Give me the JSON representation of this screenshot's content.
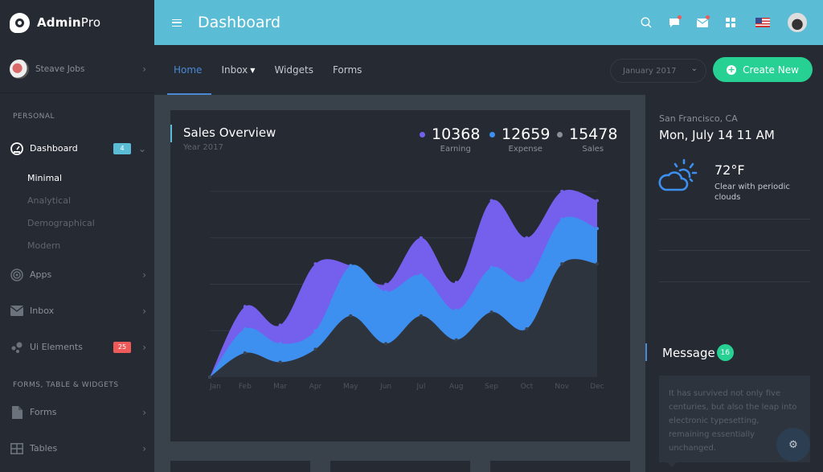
{
  "brand": {
    "bold": "Admin",
    "light": "Pro"
  },
  "user": {
    "name": "Steave Jobs"
  },
  "sidebar": {
    "sections": [
      {
        "title": "PERSONAL"
      },
      {
        "title": "FORMS, TABLE & WIDGETS"
      }
    ],
    "items": [
      {
        "label": "Dashboard",
        "icon": "dashboard-icon",
        "badge": "4",
        "badge_color": "#5bbdd5",
        "active": true,
        "children": [
          {
            "label": "Minimal",
            "active": true
          },
          {
            "label": "Analytical"
          },
          {
            "label": "Demographical"
          },
          {
            "label": "Modern"
          }
        ]
      },
      {
        "label": "Apps",
        "icon": "target-icon"
      },
      {
        "label": "Inbox",
        "icon": "envelope-icon"
      },
      {
        "label": "Ui Elements",
        "icon": "bubbles-icon",
        "badge": "25",
        "badge_color": "#ee5a5a"
      },
      {
        "label": "Forms",
        "icon": "file-icon"
      },
      {
        "label": "Tables",
        "icon": "table-icon"
      }
    ]
  },
  "topbar": {
    "title": "Dashboard",
    "icons": [
      "search-icon",
      "chat-icon",
      "mail-icon",
      "apps-grid-icon",
      "us-flag-icon",
      "user-avatar"
    ]
  },
  "subnav": {
    "tabs": [
      {
        "label": "Home",
        "active": true
      },
      {
        "label": "Inbox",
        "dropdown": true
      },
      {
        "label": "Widgets"
      },
      {
        "label": "Forms"
      }
    ],
    "month_select": "January 2017",
    "create_label": "Create New"
  },
  "sales_card": {
    "title": "Sales Overview",
    "subtitle": "Year 2017",
    "legend": [
      {
        "value": "10368",
        "label": "Earning",
        "color": "#7560ee"
      },
      {
        "value": "12659",
        "label": "Expense",
        "color": "#3d8ff0"
      },
      {
        "value": "15478",
        "label": "Sales",
        "color": "#8a909a"
      }
    ]
  },
  "chart_data": {
    "type": "area",
    "stacked": true,
    "title": "Sales Overview",
    "subtitle": "Year 2017",
    "categories": [
      "Jan",
      "Feb",
      "Mar",
      "Apr",
      "May",
      "Jun",
      "Jul",
      "Aug",
      "Sep",
      "Oct",
      "Nov",
      "Dec"
    ],
    "series": [
      {
        "name": "Sales",
        "color": "#2e343d",
        "values": [
          0,
          13,
          8,
          15,
          33,
          18,
          33,
          20,
          35,
          26,
          61,
          61
        ]
      },
      {
        "name": "Expense",
        "color": "#3d8ff0",
        "values": [
          0,
          13,
          10,
          10,
          27,
          28,
          22,
          16,
          24,
          26,
          24,
          19
        ]
      },
      {
        "name": "Earning",
        "color": "#7560ee",
        "values": [
          0,
          12,
          10,
          36,
          0,
          4,
          20,
          15,
          36,
          23,
          15,
          15
        ]
      }
    ],
    "ylim": [
      0,
      100
    ],
    "ygrid": [
      25,
      50,
      75,
      100
    ],
    "grid": true,
    "xlabel": "",
    "ylabel": "",
    "legend_position": "top-right"
  },
  "weather": {
    "location": "San Francisco, CA",
    "datetime": "Mon, July 14 11 AM",
    "temperature": "72°F",
    "description": "Clear with periodic clouds",
    "icon": "partly-cloudy-icon"
  },
  "messages": {
    "title": "Message",
    "count": "16",
    "text": "It has survived not only five centuries, but also the leap into electronic typesetting, remaining essentially unchanged."
  }
}
